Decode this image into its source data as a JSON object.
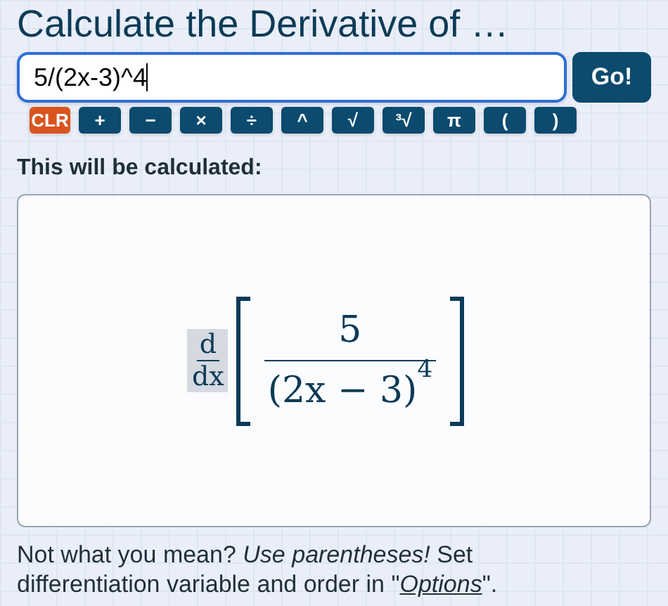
{
  "title": "Calculate the Derivative of …",
  "input": {
    "value": "5/(2x-3)^4"
  },
  "go_button": "Go!",
  "keypad": [
    {
      "kind": "clear",
      "label": "CLR"
    },
    {
      "kind": "key",
      "label": "+"
    },
    {
      "kind": "key",
      "label": "−"
    },
    {
      "kind": "key",
      "label": "×"
    },
    {
      "kind": "key",
      "label": "÷"
    },
    {
      "kind": "key",
      "label": "^"
    },
    {
      "kind": "key",
      "label": "√"
    },
    {
      "kind": "key",
      "label": "³√"
    },
    {
      "kind": "key",
      "label": "π"
    },
    {
      "kind": "key",
      "label": "("
    },
    {
      "kind": "key",
      "label": ")"
    }
  ],
  "preview_heading": "This will be calculated:",
  "formula": {
    "operator_top": "d",
    "operator_bottom": "dx",
    "numerator": "5",
    "denominator": "(2x − 3)",
    "exponent": "4"
  },
  "footer": {
    "before": "Not what you mean? *Use parentheses!* Set differentiation variable and order in \"",
    "link": "Options",
    "after": "\"."
  }
}
